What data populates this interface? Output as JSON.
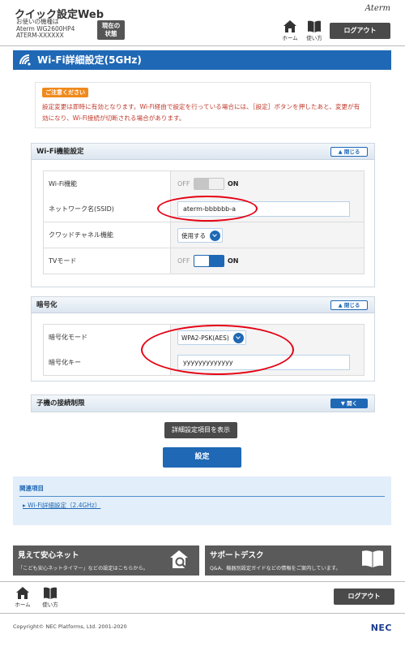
{
  "header": {
    "app_title": "クイック設定Web",
    "device_label_line1": "お使いの機種は",
    "device_model": "Aterm WG2600HP4",
    "device_id": "ATERM-XXXXXX",
    "status_button_label_line1": "現在の",
    "status_button_label_line2": "状態",
    "brand": "Aterm",
    "home_label": "ホーム",
    "manual_label": "使い方",
    "logout_label": "ログアウト"
  },
  "page": {
    "title": "Wi-Fi詳細設定(5GHz)"
  },
  "notice": {
    "badge": "ご注意ください",
    "text": "設定変更は即時に有効となります。Wi-Fi経由で設定を行っている場合には、［設定］ボタンを押したあと、変更が有効になり、Wi-Fi接続が切断される場合があります。"
  },
  "wifi_section": {
    "title": "Wi-Fi機能設定",
    "toggle_label": "閉じる",
    "rows": [
      {
        "label": "Wi-Fi機能",
        "off_label": "OFF",
        "on_label": "ON",
        "enabled": false
      },
      {
        "label": "ネットワーク名(SSID)",
        "value": "aterm-bbbbbb-a"
      },
      {
        "label": "クワッドチャネル機能",
        "value": "使用する"
      },
      {
        "label": "TVモード",
        "off_label": "OFF",
        "on_label": "ON",
        "enabled": true
      }
    ]
  },
  "encryption_section": {
    "title": "暗号化",
    "toggle_label": "閉じる",
    "rows": [
      {
        "label": "暗号化モード",
        "value": "WPA2-PSK(AES)"
      },
      {
        "label": "暗号化キー",
        "value": "yyyyyyyyyyyyy"
      }
    ]
  },
  "client_section": {
    "title": "子機の接続制限",
    "toggle_label": "開く"
  },
  "buttons": {
    "detail_label": "詳細設定項目を表示",
    "set_label": "設定"
  },
  "related": {
    "heading": "関連項目",
    "link": "Wi-Fi詳細設定（2.4GHz）"
  },
  "promo": {
    "left_title": "見えて安心ネット",
    "left_sub": "「こども安心ネットタイマー」などの設定はこちらから。",
    "right_title": "サポートデスク",
    "right_sub": "Q&A、機器別設定ガイドなどの情報をご案内しています。"
  },
  "footer": {
    "home_label": "ホーム",
    "manual_label": "使い方",
    "logout_label": "ログアウト",
    "copyright": "Copyright© NEC Platforms, Ltd. 2001-2020",
    "nec_logo": "NEC"
  },
  "colors": {
    "primary_blue": "#1f68b5",
    "highlight_red": "#e60012",
    "notice_red": "#c0392b",
    "badge_orange": "#f08a1c"
  }
}
